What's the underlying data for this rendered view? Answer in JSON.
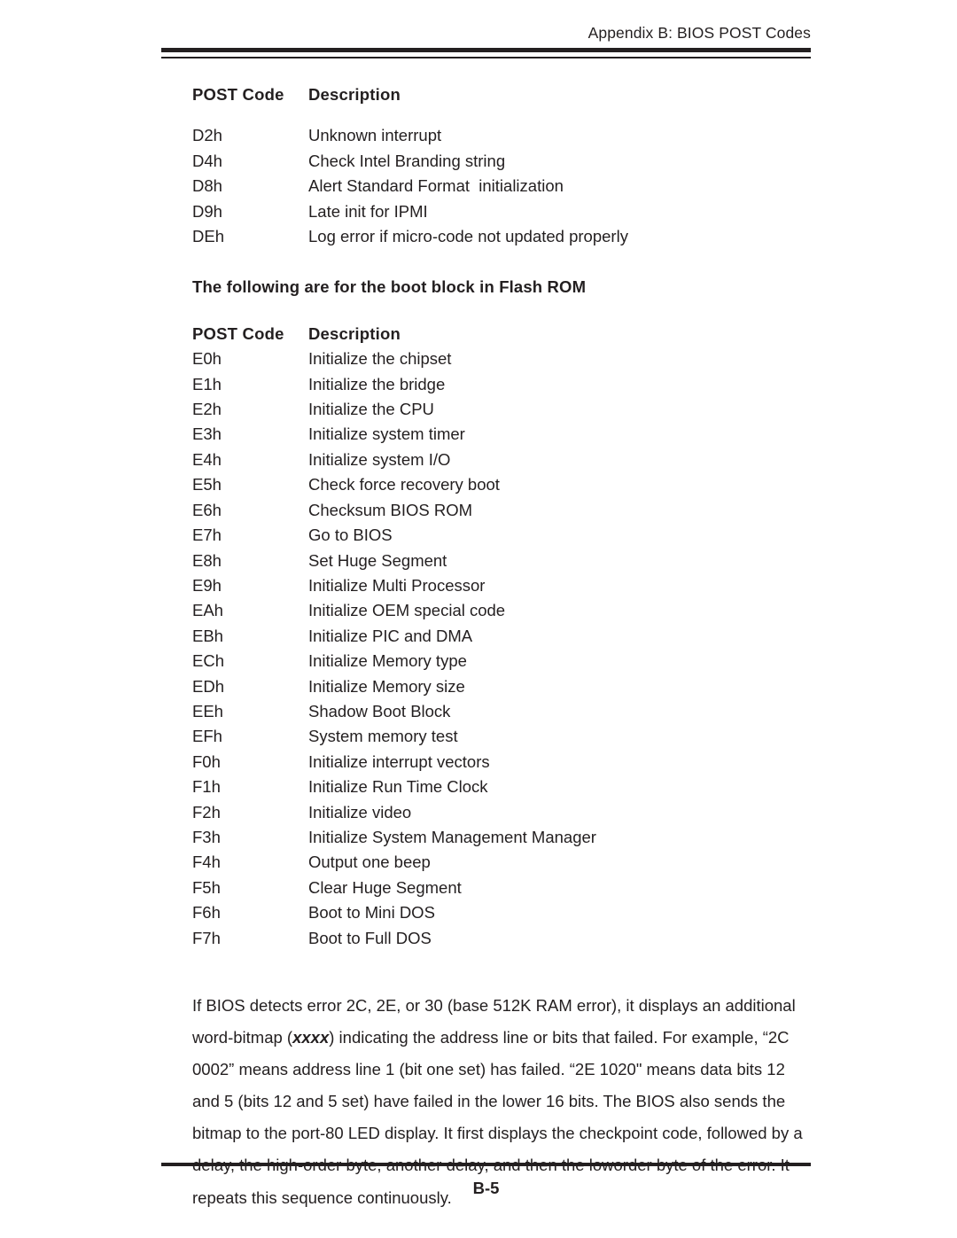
{
  "header": {
    "running_head": "Appendix B: BIOS POST Codes"
  },
  "table_one": {
    "headers": {
      "code": "POST Code",
      "description": "Description"
    },
    "rows": [
      {
        "code": "D2h",
        "description": "Unknown interrupt"
      },
      {
        "code": "D4h",
        "description": "Check Intel Branding string"
      },
      {
        "code": "D8h",
        "description": "Alert Standard Format  initialization"
      },
      {
        "code": "D9h",
        "description": "Late init for IPMI"
      },
      {
        "code": "DEh",
        "description": "Log error if micro-code not updated properly"
      }
    ]
  },
  "section_heading": "The following are for the boot block in Flash ROM",
  "table_two": {
    "headers": {
      "code": "POST Code",
      "description": "Description"
    },
    "rows": [
      {
        "code": "E0h",
        "description": "Initialize the chipset"
      },
      {
        "code": "E1h",
        "description": "Initialize the bridge"
      },
      {
        "code": "E2h",
        "description": "Initialize the CPU"
      },
      {
        "code": "E3h",
        "description": "Initialize system timer"
      },
      {
        "code": "E4h",
        "description": "Initialize system I/O"
      },
      {
        "code": "E5h",
        "description": "Check force recovery boot"
      },
      {
        "code": "E6h",
        "description": "Checksum BIOS ROM"
      },
      {
        "code": "E7h",
        "description": "Go to BIOS"
      },
      {
        "code": "E8h",
        "description": "Set Huge Segment"
      },
      {
        "code": "E9h",
        "description": "Initialize Multi Processor"
      },
      {
        "code": "EAh",
        "description": "Initialize OEM special code"
      },
      {
        "code": "EBh",
        "description": "Initialize PIC and DMA"
      },
      {
        "code": "ECh",
        "description": "Initialize Memory type"
      },
      {
        "code": "EDh",
        "description": "Initialize Memory size"
      },
      {
        "code": "EEh",
        "description": "Shadow Boot Block"
      },
      {
        "code": "EFh",
        "description": "System memory test"
      },
      {
        "code": "F0h",
        "description": "Initialize interrupt vectors"
      },
      {
        "code": "F1h",
        "description": "Initialize Run Time Clock"
      },
      {
        "code": "F2h",
        "description": "Initialize video"
      },
      {
        "code": "F3h",
        "description": "Initialize System Management Manager"
      },
      {
        "code": "F4h",
        "description": "Output one beep"
      },
      {
        "code": "F5h",
        "description": "Clear Huge Segment"
      },
      {
        "code": "F6h",
        "description": "Boot to Mini DOS"
      },
      {
        "code": "F7h",
        "description": "Boot to Full DOS"
      }
    ]
  },
  "note": {
    "part1": "If BIOS detects error 2C, 2E, or 30 (base 512K RAM error), it displays an additional word-bitmap (",
    "emphasis": "xxxx",
    "part2": ") indicating the address line or bits that failed.  For example, “2C 0002” means address line 1 (bit one set) has failed.  “2E 1020\" means data bits 12 and 5 (bits 12 and 5 set) have failed in the lower 16 bits.  The BIOS also sends the bitmap to the port-80 LED display.  It first displays the checkpoint code, followed by a delay, the high-order byte, another delay, and then the loworder byte of the error.  It repeats this sequence continuously."
  },
  "footer": {
    "page_number": "B-5"
  }
}
